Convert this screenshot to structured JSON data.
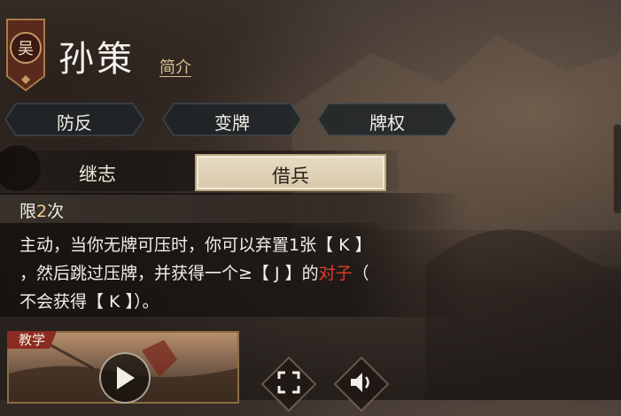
{
  "hero": {
    "faction": "吴",
    "name": "孙策",
    "intro_link": "简介"
  },
  "tags": [
    "防反",
    "变牌",
    "牌权"
  ],
  "skills": {
    "tabs": [
      "继志",
      "借兵"
    ],
    "active_index": 1
  },
  "skill_detail": {
    "limit_prefix": "限",
    "limit_count": "2",
    "limit_suffix": "次",
    "line1": "主动，当你无牌可压时，你可以弃置1张【 K 】",
    "line2_main": "，然后跳过压牌，并获得一个≥【 J 】的",
    "line2_highlight": "对子",
    "line2_end": "（",
    "line3": "不会获得【 K 】）。"
  },
  "tutorial": {
    "label": "教学"
  },
  "icons": {
    "play": "play-icon",
    "fullscreen": "fullscreen-icon",
    "speaker": "speaker-icon"
  },
  "colors": {
    "highlight_red": "#e23a2c",
    "gold": "#d8c08a",
    "active_tab": "#e7dcc4"
  }
}
